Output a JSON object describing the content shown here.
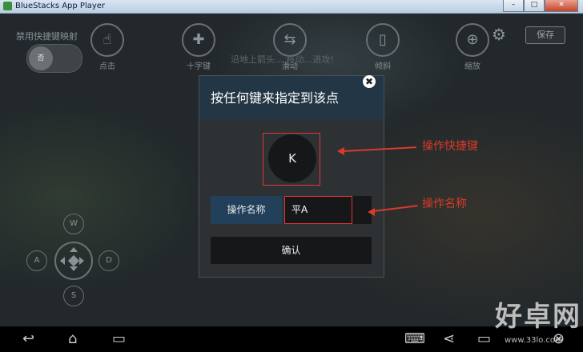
{
  "window": {
    "title": "BlueStacks App Player",
    "minimize": "–",
    "maximize": "□",
    "close": "✕"
  },
  "toolbar": {
    "disable_label": "禁用快捷键映射",
    "toggle_text": "否",
    "tools": [
      {
        "label": "点击",
        "icon": "tap-icon",
        "glyph": "☝"
      },
      {
        "label": "十字键",
        "icon": "dpad-icon",
        "glyph": "✚"
      },
      {
        "label": "滑动",
        "icon": "swipe-icon",
        "glyph": "⇆"
      },
      {
        "label": "倾斜",
        "icon": "tilt-icon",
        "glyph": "▯"
      },
      {
        "label": "缩放",
        "icon": "zoom-icon",
        "glyph": "⊕"
      }
    ],
    "settings_glyph": "⚙",
    "save_label": "保存",
    "hint": "沿地上箭头… 移动…进攻!"
  },
  "dpad": {
    "up": "W",
    "left": "A",
    "right": "D",
    "down": "S"
  },
  "dialog": {
    "title": "按任何键来指定到该点",
    "close": "✖",
    "key": "K",
    "name_label": "操作名称",
    "name_value": "平A",
    "confirm": "确认"
  },
  "annotations": {
    "shortcut": "操作快捷键",
    "name": "操作名称"
  },
  "navbar": {
    "back": "↩",
    "home": "⌂",
    "recent": "▭",
    "keyboard": "⌨",
    "share": "⋖",
    "screen": "▭",
    "close": "⊗"
  },
  "watermark": {
    "text": "好卓网",
    "url": "www.33lo.com"
  },
  "colors": {
    "annotation": "#d83b2a",
    "dialog_header": "#233645",
    "name_label_bg": "#22405a"
  }
}
